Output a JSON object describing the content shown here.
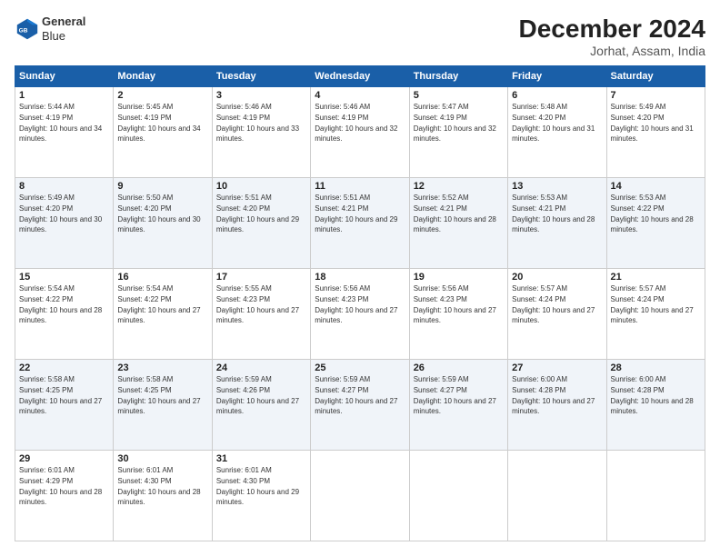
{
  "header": {
    "logo_line1": "General",
    "logo_line2": "Blue",
    "month_title": "December 2024",
    "location": "Jorhat, Assam, India"
  },
  "weekdays": [
    "Sunday",
    "Monday",
    "Tuesday",
    "Wednesday",
    "Thursday",
    "Friday",
    "Saturday"
  ],
  "weeks": [
    [
      {
        "day": "1",
        "rise": "5:44 AM",
        "set": "4:19 PM",
        "daylight": "10 hours and 34 minutes."
      },
      {
        "day": "2",
        "rise": "5:45 AM",
        "set": "4:19 PM",
        "daylight": "10 hours and 34 minutes."
      },
      {
        "day": "3",
        "rise": "5:46 AM",
        "set": "4:19 PM",
        "daylight": "10 hours and 33 minutes."
      },
      {
        "day": "4",
        "rise": "5:46 AM",
        "set": "4:19 PM",
        "daylight": "10 hours and 32 minutes."
      },
      {
        "day": "5",
        "rise": "5:47 AM",
        "set": "4:19 PM",
        "daylight": "10 hours and 32 minutes."
      },
      {
        "day": "6",
        "rise": "5:48 AM",
        "set": "4:20 PM",
        "daylight": "10 hours and 31 minutes."
      },
      {
        "day": "7",
        "rise": "5:49 AM",
        "set": "4:20 PM",
        "daylight": "10 hours and 31 minutes."
      }
    ],
    [
      {
        "day": "8",
        "rise": "5:49 AM",
        "set": "4:20 PM",
        "daylight": "10 hours and 30 minutes."
      },
      {
        "day": "9",
        "rise": "5:50 AM",
        "set": "4:20 PM",
        "daylight": "10 hours and 30 minutes."
      },
      {
        "day": "10",
        "rise": "5:51 AM",
        "set": "4:20 PM",
        "daylight": "10 hours and 29 minutes."
      },
      {
        "day": "11",
        "rise": "5:51 AM",
        "set": "4:21 PM",
        "daylight": "10 hours and 29 minutes."
      },
      {
        "day": "12",
        "rise": "5:52 AM",
        "set": "4:21 PM",
        "daylight": "10 hours and 28 minutes."
      },
      {
        "day": "13",
        "rise": "5:53 AM",
        "set": "4:21 PM",
        "daylight": "10 hours and 28 minutes."
      },
      {
        "day": "14",
        "rise": "5:53 AM",
        "set": "4:22 PM",
        "daylight": "10 hours and 28 minutes."
      }
    ],
    [
      {
        "day": "15",
        "rise": "5:54 AM",
        "set": "4:22 PM",
        "daylight": "10 hours and 28 minutes."
      },
      {
        "day": "16",
        "rise": "5:54 AM",
        "set": "4:22 PM",
        "daylight": "10 hours and 27 minutes."
      },
      {
        "day": "17",
        "rise": "5:55 AM",
        "set": "4:23 PM",
        "daylight": "10 hours and 27 minutes."
      },
      {
        "day": "18",
        "rise": "5:56 AM",
        "set": "4:23 PM",
        "daylight": "10 hours and 27 minutes."
      },
      {
        "day": "19",
        "rise": "5:56 AM",
        "set": "4:23 PM",
        "daylight": "10 hours and 27 minutes."
      },
      {
        "day": "20",
        "rise": "5:57 AM",
        "set": "4:24 PM",
        "daylight": "10 hours and 27 minutes."
      },
      {
        "day": "21",
        "rise": "5:57 AM",
        "set": "4:24 PM",
        "daylight": "10 hours and 27 minutes."
      }
    ],
    [
      {
        "day": "22",
        "rise": "5:58 AM",
        "set": "4:25 PM",
        "daylight": "10 hours and 27 minutes."
      },
      {
        "day": "23",
        "rise": "5:58 AM",
        "set": "4:25 PM",
        "daylight": "10 hours and 27 minutes."
      },
      {
        "day": "24",
        "rise": "5:59 AM",
        "set": "4:26 PM",
        "daylight": "10 hours and 27 minutes."
      },
      {
        "day": "25",
        "rise": "5:59 AM",
        "set": "4:27 PM",
        "daylight": "10 hours and 27 minutes."
      },
      {
        "day": "26",
        "rise": "5:59 AM",
        "set": "4:27 PM",
        "daylight": "10 hours and 27 minutes."
      },
      {
        "day": "27",
        "rise": "6:00 AM",
        "set": "4:28 PM",
        "daylight": "10 hours and 27 minutes."
      },
      {
        "day": "28",
        "rise": "6:00 AM",
        "set": "4:28 PM",
        "daylight": "10 hours and 28 minutes."
      }
    ],
    [
      {
        "day": "29",
        "rise": "6:01 AM",
        "set": "4:29 PM",
        "daylight": "10 hours and 28 minutes."
      },
      {
        "day": "30",
        "rise": "6:01 AM",
        "set": "4:30 PM",
        "daylight": "10 hours and 28 minutes."
      },
      {
        "day": "31",
        "rise": "6:01 AM",
        "set": "4:30 PM",
        "daylight": "10 hours and 29 minutes."
      },
      null,
      null,
      null,
      null
    ]
  ]
}
